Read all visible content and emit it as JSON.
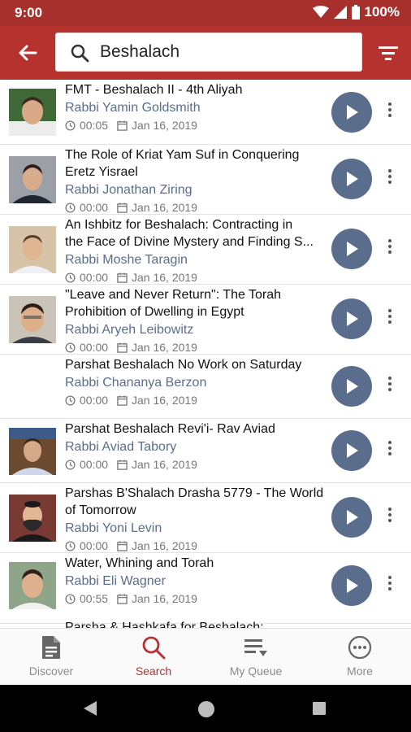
{
  "status_bar": {
    "time": "9:00",
    "battery": "100%"
  },
  "search": {
    "query": "Beshalach",
    "placeholder": ""
  },
  "results": [
    {
      "title": "FMT - Beshalach II - 4th Aliyah",
      "speaker": "Rabbi Yamin Goldsmith",
      "duration": "00:05",
      "date": "Jan 16, 2019"
    },
    {
      "title": "The Role of Kriat Yam Suf in Conquering Eretz Yisrael",
      "speaker": "Rabbi Jonathan Ziring",
      "duration": "00:00",
      "date": "Jan 16, 2019"
    },
    {
      "title_line1": "An Ishbitz for Beshalach: Contracting in",
      "title_line2": "the Face of Divine Mystery and Finding S...",
      "speaker": "Rabbi Moshe Taragin",
      "duration": "00:00",
      "date": "Jan 16, 2019"
    },
    {
      "title": "\"Leave and Never Return\": The Torah Prohibition of Dwelling in Egypt",
      "speaker": "Rabbi Aryeh Leibowitz",
      "duration": "00:00",
      "date": "Jan 16, 2019"
    },
    {
      "title": "Parshat Beshalach No Work on Saturday",
      "speaker": "Rabbi Chananya Berzon",
      "duration": "00:00",
      "date": "Jan 16, 2019"
    },
    {
      "title": "Parshat Beshalach Revi'i- Rav Aviad",
      "speaker": "Rabbi Aviad Tabory",
      "duration": "00:00",
      "date": "Jan 16, 2019"
    },
    {
      "title": "Parshas B'Shalach Drasha 5779 - The World of Tomorrow",
      "speaker": "Rabbi Yoni Levin",
      "duration": "00:00",
      "date": "Jan 16, 2019"
    },
    {
      "title": "Water, Whining and Torah",
      "speaker": "Rabbi Eli Wagner",
      "duration": "00:55",
      "date": "Jan 16, 2019"
    },
    {
      "title": "Parsha & Hashkafa for Beshalach:"
    }
  ],
  "bottom_nav": {
    "discover": "Discover",
    "search": "Search",
    "queue": "My Queue",
    "more": "More"
  },
  "colors": {
    "brand": "#b5322e",
    "status_bar": "#a8302c",
    "play": "#5a6d8c",
    "speaker": "#5b6d8c"
  }
}
